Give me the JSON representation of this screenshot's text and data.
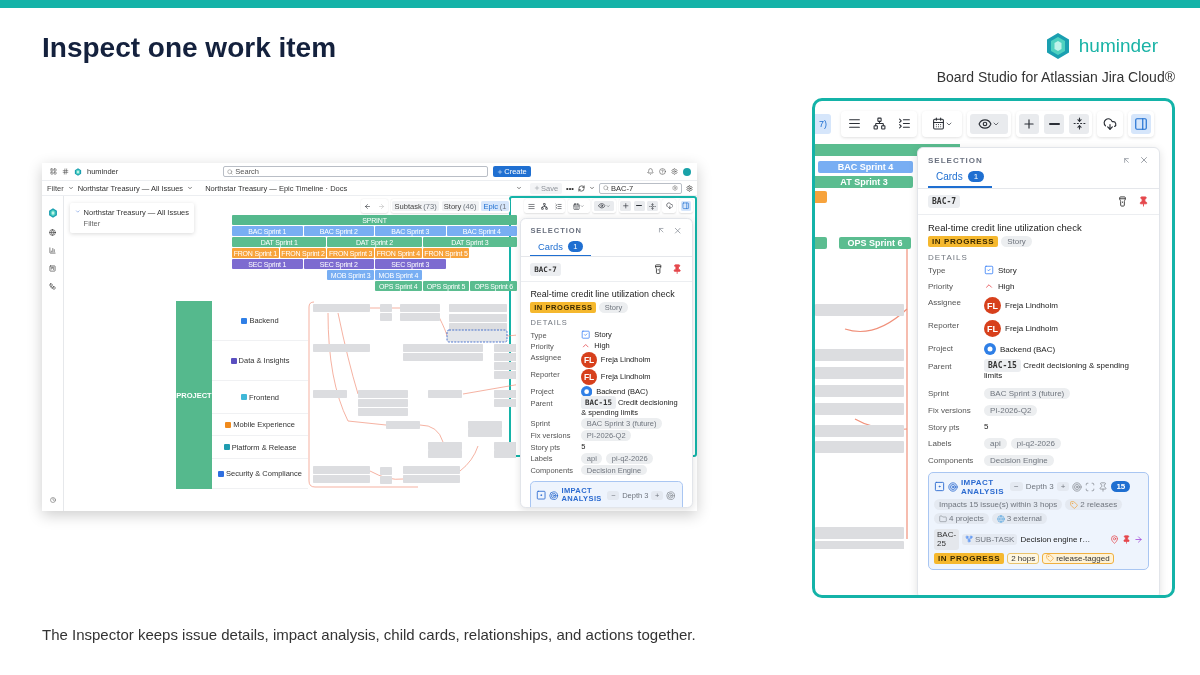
{
  "slide": {
    "title": "Inspect one work item",
    "brand": "huminder",
    "tagline": "Board Studio for Atlassian Jira Cloud®",
    "caption": "The Inspector keeps issue details, impact analysis, child cards, relationships, and actions together."
  },
  "app": {
    "topbar": {
      "brand": "huminder",
      "search": {
        "placeholder": "Search"
      },
      "create": "Create"
    },
    "filterbar": {
      "filter": "Filter",
      "board": "Northstar Treasury — All Issues",
      "view": "Northstar Treasury — Epic Timeline · Docs",
      "save": {
        "label": "Save",
        "disabled": true
      },
      "more": "•••",
      "search": {
        "value": "BAC-7"
      }
    },
    "filter_card": {
      "title": "Northstar Treasury — All Issues",
      "subtitle": "Filter"
    },
    "toolbar": {
      "chips": [
        {
          "label": "Subtask",
          "count": "(73)",
          "selected": false
        },
        {
          "label": "Story",
          "count": "(46)",
          "selected": false
        },
        {
          "label": "Epic",
          "count": "(1",
          "selected": true
        }
      ],
      "inspector_open": true
    },
    "sprint_header": "SPRINT",
    "sprint_rows": [
      {
        "color": "#78aef3",
        "bars": [
          "BAC Sprint 1",
          "BAC Sprint 2",
          "BAC Sprint 3",
          "BAC Sprint 4"
        ]
      },
      {
        "color": "#5bbd90",
        "bars": [
          "DAT Sprint 1",
          "DAT Sprint 2",
          "DAT Sprint 3"
        ]
      },
      {
        "color": "#f7a33c",
        "bars": [
          "FRON Sprint 1",
          "FRON Sprint 2",
          "FRON Sprint 3",
          "FRON Sprint 4",
          "FRON Sprint 5"
        ]
      },
      {
        "color": "#7d6bd0",
        "bars": [
          "SEC Sprint 1",
          "SEC Sprint 2",
          "SEC Sprint 3"
        ]
      },
      {
        "color": "#78aef3",
        "bars": [
          "MOB Sprint 3",
          "MOB Sprint 4"
        ]
      },
      {
        "color": "#5bbd90",
        "bars": [
          "OPS Sprint 4",
          "OPS Sprint 5",
          "OPS Sprint 6"
        ]
      }
    ],
    "swimlane": {
      "title": "PROJECT",
      "lanes": [
        {
          "name": "Backend",
          "color": "#2f7fe6"
        },
        {
          "name": "Data & Insights",
          "color": "#5a4fc0"
        },
        {
          "name": "Frontend",
          "color": "#3fb8d8"
        },
        {
          "name": "Mobile Experience",
          "color": "#f08a1c"
        },
        {
          "name": "Platform & Release",
          "color": "#1f9cb0"
        },
        {
          "name": "Security & Compliance",
          "color": "#2f6fe0"
        }
      ]
    },
    "inspector": {
      "heading": "SELECTION",
      "tabs": [
        {
          "label": "Cards",
          "count": "1",
          "selected": true
        }
      ],
      "key": "BAC-7",
      "title": "Real-time credit line utilization check",
      "status": "IN PROGRESS",
      "type": "Story",
      "section": "DETAILS",
      "fields": [
        {
          "label": "Type",
          "kind": "type",
          "value": "Story"
        },
        {
          "label": "Priority",
          "kind": "priority",
          "value": "High"
        },
        {
          "label": "Assignee",
          "kind": "person",
          "initials": "FL",
          "value": "Freja Lindholm"
        },
        {
          "label": "Reporter",
          "kind": "person",
          "initials": "FL",
          "value": "Freja Lindholm"
        },
        {
          "label": "Project",
          "kind": "project",
          "value": "Backend (BAC)"
        },
        {
          "label": "Parent",
          "kind": "parent",
          "key": "BAC-15",
          "value": "Credit decisioning & spending limits"
        },
        {
          "label": "Sprint",
          "kind": "chips",
          "chips": [
            "BAC Sprint 3 (future)"
          ]
        },
        {
          "label": "Fix versions",
          "kind": "chips",
          "chips": [
            "PI-2026-Q2"
          ]
        },
        {
          "label": "Story pts",
          "kind": "text",
          "value": "5"
        },
        {
          "label": "Labels",
          "kind": "chips",
          "chips": [
            "api",
            "pi-q2-2026"
          ]
        },
        {
          "label": "Components",
          "kind": "chips",
          "chips": [
            "Decision Engine"
          ]
        }
      ],
      "impact": {
        "title": "IMPACT ANALYSIS",
        "minus": "−",
        "depth": "Depth 3",
        "plus": "+"
      }
    }
  },
  "zoom": {
    "toolbar_chip": {
      "text": "7)",
      "selected": true
    },
    "inspector_open": true,
    "sprint_bars": [
      {
        "color": "#5bbd90"
      },
      {
        "text": "BAC Sprint 4",
        "color": "#78aef3"
      },
      {
        "text": "AT Sprint 3",
        "color": "#5bbd90"
      },
      {
        "color": "#f7a33c"
      },
      {
        "color": "#5bbd90"
      },
      {
        "text": "OPS Sprint 6",
        "color": "#5bbd90"
      }
    ],
    "inspector": {
      "heading": "SELECTION",
      "tabs": [
        {
          "label": "Cards",
          "count": "1",
          "selected": true
        }
      ],
      "key": "BAC-7",
      "title": "Real-time credit line utilization check",
      "status": "IN PROGRESS",
      "type": "Story",
      "section": "DETAILS",
      "fields": [
        {
          "label": "Type",
          "kind": "type",
          "value": "Story"
        },
        {
          "label": "Priority",
          "kind": "priority",
          "value": "High"
        },
        {
          "label": "Assignee",
          "kind": "person",
          "initials": "FL",
          "value": "Freja Lindholm"
        },
        {
          "label": "Reporter",
          "kind": "person",
          "initials": "FL",
          "value": "Freja Lindholm"
        },
        {
          "label": "Project",
          "kind": "project",
          "value": "Backend (BAC)"
        },
        {
          "label": "Parent",
          "kind": "parent",
          "key": "BAC-15",
          "value": "Credit decisioning & spending limits"
        },
        {
          "label": "Sprint",
          "kind": "chips",
          "chips": [
            "BAC Sprint 3 (future)"
          ]
        },
        {
          "label": "Fix versions",
          "kind": "chips",
          "chips": [
            "PI-2026-Q2"
          ]
        },
        {
          "label": "Story pts",
          "kind": "text",
          "value": "5"
        },
        {
          "label": "Labels",
          "kind": "chips",
          "chips": [
            "api",
            "pi-q2-2026"
          ]
        },
        {
          "label": "Components",
          "kind": "chips",
          "chips": [
            "Decision Engine"
          ]
        }
      ],
      "impact": {
        "title": "IMPACT ANALYSIS",
        "minus": "−",
        "depth": "Depth 3",
        "plus": "+",
        "count": "15",
        "chips": [
          {
            "kind": "plain",
            "text": "Impacts 15 issue(s) within 3 hops"
          },
          {
            "kind": "release",
            "text": "2 releases"
          },
          {
            "kind": "projects",
            "text": "4 projects"
          },
          {
            "kind": "external",
            "text": "3 external"
          }
        ],
        "items": [
          {
            "key": "BAC-25",
            "kind": "subtask",
            "type": "SUB-TASK",
            "title": "Decision engine r…",
            "tags": [
              {
                "kind": "in-progress",
                "text": "IN PROGRESS"
              },
              {
                "kind": "hops",
                "text": "2 hops"
              },
              {
                "kind": "release",
                "text": "release-tagged"
              }
            ]
          }
        ]
      }
    }
  }
}
